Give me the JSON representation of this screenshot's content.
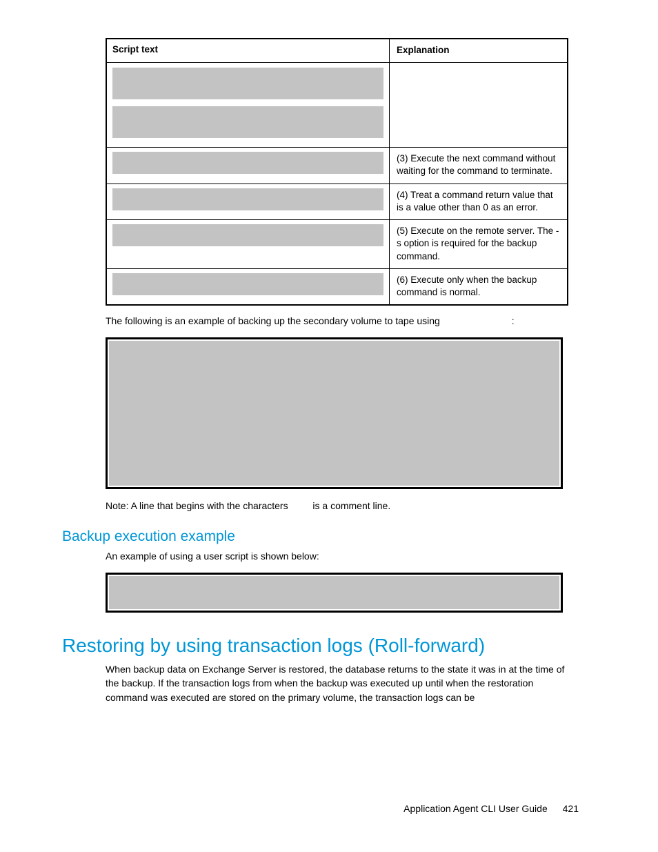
{
  "table": {
    "header_left": "Script text",
    "header_right": "Explanation",
    "rows": [
      {
        "right": ""
      },
      {
        "right": "(3) Execute the next command without waiting for the command to terminate."
      },
      {
        "right": "(4) Treat a command return value that is a value other than 0 as an error."
      },
      {
        "right": "(5) Execute on the remote server. The -s option is required for the backup command."
      },
      {
        "right": "(6) Execute only when the backup command is normal."
      }
    ]
  },
  "para1_a": "The following is an example of backing up the secondary volume to tape using ",
  "para1_b": ":",
  "note_a": "Note: A line that begins with the characters ",
  "note_b": " is a comment line.",
  "subhead": "Backup execution example",
  "subtext": "An example of using a user script is shown below:",
  "majorhead": "Restoring by using transaction logs (Roll-forward)",
  "majortext": "When backup data on Exchange Server is restored, the database returns to the state it was in at the time of the backup. If the transaction logs from when the backup was executed up until when the restoration command was executed are stored on the primary volume, the transaction logs can be",
  "footer_label": "Application Agent CLI User Guide",
  "footer_page": "421"
}
